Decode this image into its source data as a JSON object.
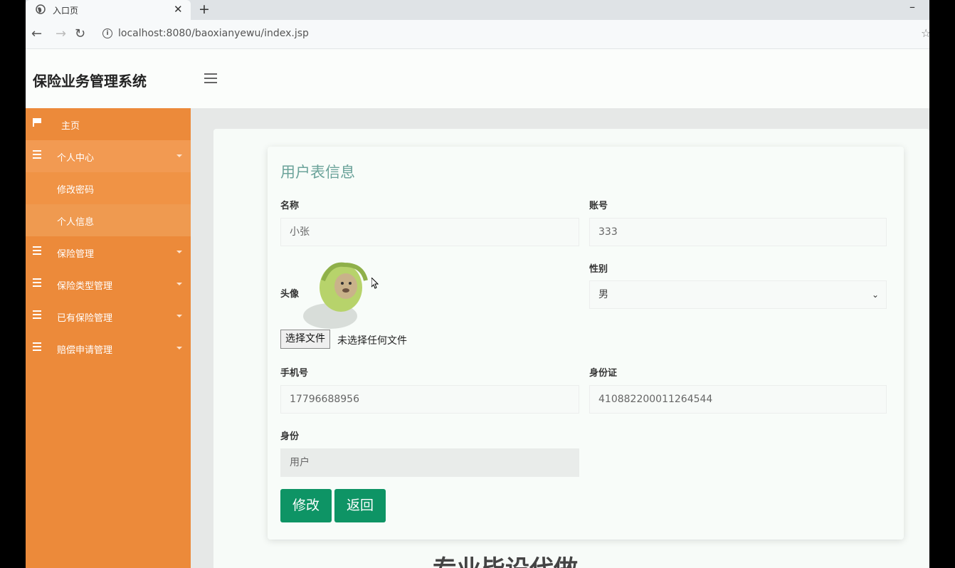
{
  "browser": {
    "tab_title": "入口页",
    "close": "✕",
    "new_tab": "+",
    "minimize": "–",
    "url": "localhost:8080/baoxianyewu/index.jsp",
    "info": "i"
  },
  "app": {
    "title": "保险业务管理系统"
  },
  "sidebar": {
    "items": [
      {
        "label": "主页",
        "icon": "flag-icon"
      },
      {
        "label": "个人中心",
        "icon": "list-icon"
      },
      {
        "label": "修改密码",
        "icon": ""
      },
      {
        "label": "个人信息",
        "icon": ""
      },
      {
        "label": "保险管理",
        "icon": "list-icon"
      },
      {
        "label": "保险类型管理",
        "icon": "list-icon"
      },
      {
        "label": "已有保险管理",
        "icon": "list-icon"
      },
      {
        "label": "赔偿申请管理",
        "icon": "list-icon"
      }
    ]
  },
  "form": {
    "title": "用户表信息",
    "name_label": "名称",
    "name_value": "小张",
    "account_label": "账号",
    "account_value": "333",
    "avatar_label": "头像",
    "gender_label": "性别",
    "gender_value": "男",
    "file_button": "选择文件",
    "file_status": "未选择任何文件",
    "phone_label": "手机号",
    "phone_value": "17796688956",
    "idcard_label": "身份证",
    "idcard_value": "410882200011264544",
    "role_label": "身份",
    "role_value": "用户",
    "edit_button": "修改",
    "back_button": "返回"
  },
  "footer": {
    "text": "专业毕设代做"
  },
  "colors": {
    "sidebar": "#ec8a3a",
    "primary_button": "#0e9465",
    "form_title": "#6ba39a"
  }
}
